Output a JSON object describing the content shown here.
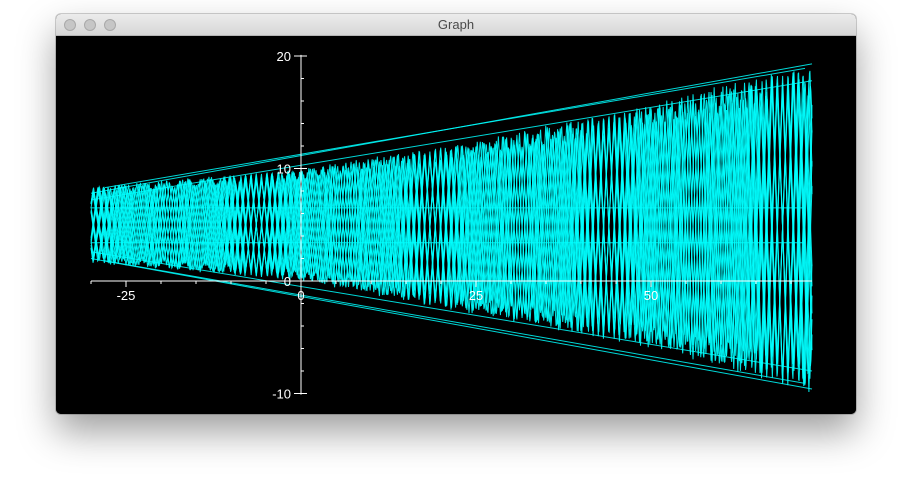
{
  "window": {
    "title": "Graph"
  },
  "colors": {
    "background": "#000000",
    "axis": "#ffffff",
    "curve": "#00ffff",
    "titlebar": "#e3e3e3"
  },
  "chart_data": {
    "type": "line",
    "title": "",
    "xlabel": "",
    "ylabel": "",
    "xlim": [
      -30,
      73
    ],
    "ylim": [
      -11,
      21
    ],
    "x_ticks": [
      {
        "value": -25,
        "label": "-25"
      },
      {
        "value": 0,
        "label": "0"
      },
      {
        "value": 25,
        "label": "25"
      },
      {
        "value": 50,
        "label": "50"
      }
    ],
    "y_ticks": [
      {
        "value": 20,
        "label": "20"
      },
      {
        "value": 10,
        "label": "10"
      },
      {
        "value": 0,
        "label": "0"
      },
      {
        "value": -10,
        "label": "-10"
      }
    ],
    "x_minor_step": 5,
    "y_minor_step": 2,
    "grid": false,
    "series": [
      {
        "color": "#00ffff",
        "description_kind": "dense oscillating zigzag curves forming a widening cone",
        "x_range": [
          -30,
          73
        ],
        "upper_envelope": [
          [
            -30,
            8.4
          ],
          [
            0,
            10.0
          ],
          [
            25,
            12.5
          ],
          [
            50,
            15.8
          ],
          [
            73,
            19.5
          ]
        ],
        "lower_envelope": [
          [
            -30,
            1.6
          ],
          [
            0,
            0.0
          ],
          [
            25,
            -3.0
          ],
          [
            50,
            -6.0
          ],
          [
            73,
            -10.0
          ]
        ]
      }
    ]
  }
}
